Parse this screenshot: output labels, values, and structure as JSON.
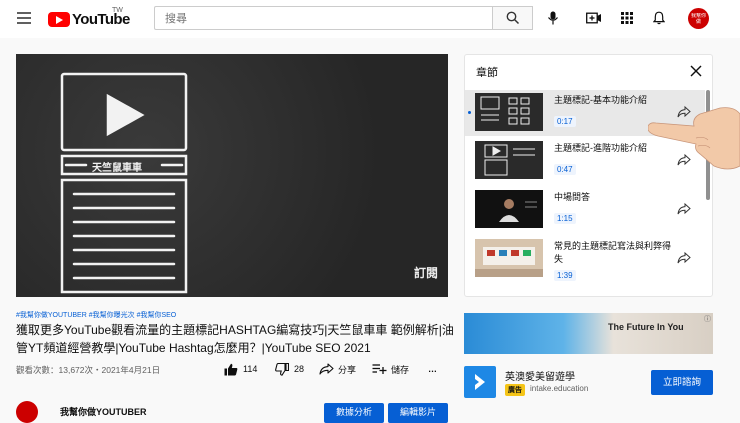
{
  "header": {
    "logo_text": "YouTube",
    "logo_region": "TW",
    "search_placeholder": "搜尋",
    "avatar_text": "我幫你做YOUTUBER"
  },
  "player": {
    "overlay_text": "訂閱",
    "board_label": "天竺鼠車車"
  },
  "video": {
    "hashtags": "#我幫你做YOUTUBER #我幫你曝光次 #我幫你SEO",
    "title": "獲取更多YouTube觀看流量的主題標記HASHTAG編寫技巧|天竺鼠車車 範例解析|油管YT頻道經營教學|YouTube Hashtag怎麼用？|YouTube SEO 2021",
    "views": "觀看次數：13,672次・2021年4月21日",
    "likes": "114",
    "dislikes": "28",
    "share_label": "分享",
    "save_label": "儲存",
    "more_label": "…"
  },
  "channel": {
    "name": "我幫你做YOUTUBER",
    "analytics_label": "數據分析",
    "edit_label": "編輯影片"
  },
  "chapters": {
    "title": "章節",
    "items": [
      {
        "name": "主題標記-基本功能介紹",
        "time": "0:17"
      },
      {
        "name": "主題標記-進階功能介紹",
        "time": "0:47"
      },
      {
        "name": "中場問答",
        "time": "1:15"
      },
      {
        "name": "常見的主題標記寫法與利弊得失",
        "time": "1:39"
      }
    ]
  },
  "ad": {
    "banner_text": "The Future In You",
    "info_icon": "ⓘ",
    "title": "英澳愛美留遊學",
    "badge": "廣告",
    "domain": "intake.education",
    "cta_label": "立即諮詢"
  },
  "colors": {
    "brand_red": "#ff0000",
    "link_blue": "#065fd4"
  }
}
